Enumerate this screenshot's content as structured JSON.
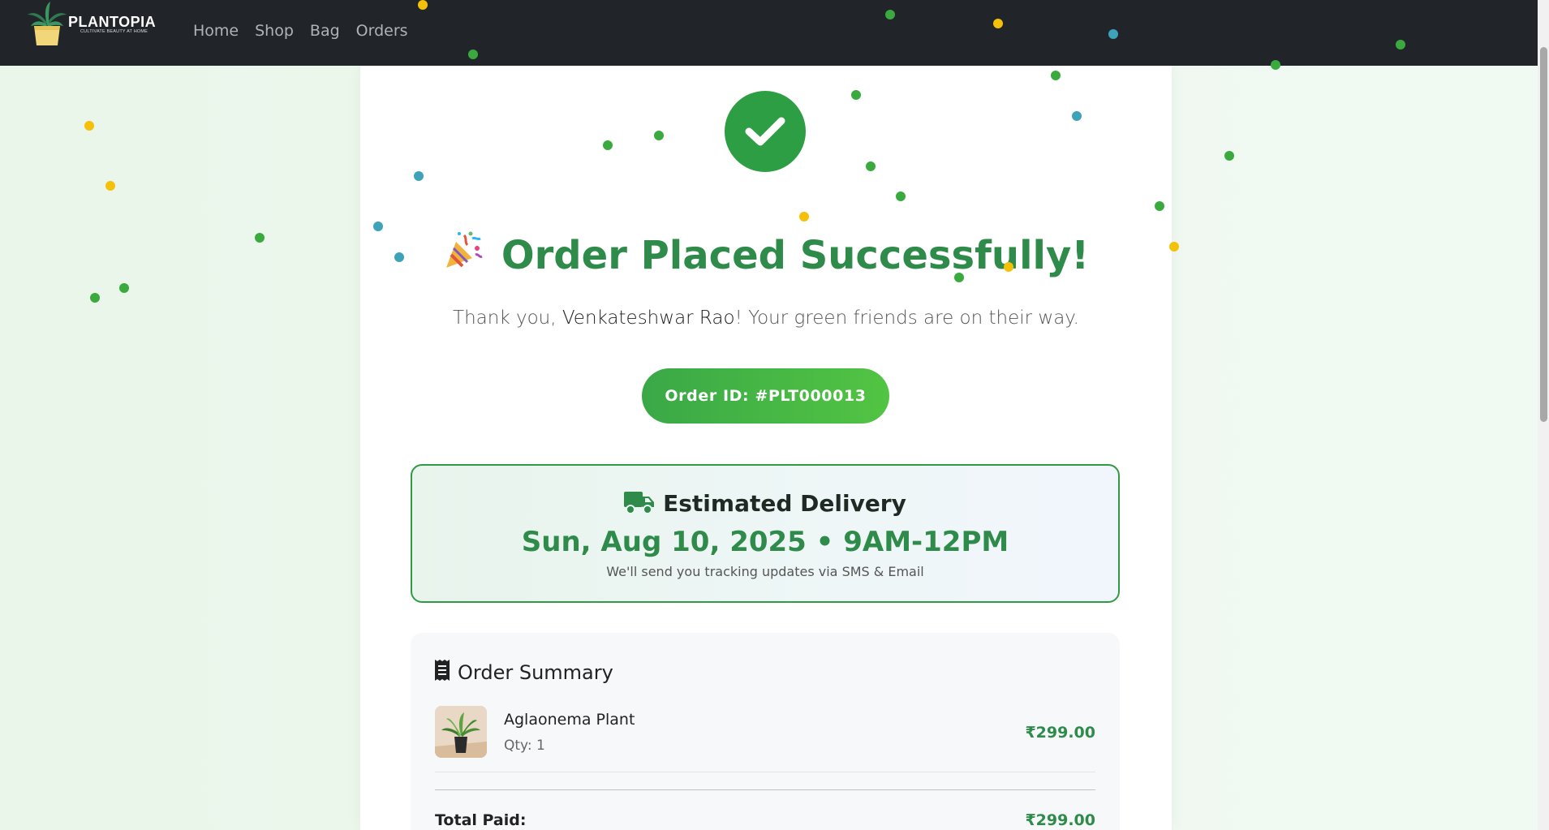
{
  "navbar": {
    "brand": "PLANTOPIA",
    "tagline": "CULTIVATE BEAUTY AT HOME",
    "links": [
      "Home",
      "Shop",
      "Bag",
      "Orders"
    ]
  },
  "confirmation": {
    "title": "Order Placed Successfully!",
    "thank_prefix": "Thank you, ",
    "customer_name": "Venkateshwar Rao",
    "thank_suffix": "! Your green friends are on their way.",
    "order_id": "Order ID: #PLT000013"
  },
  "delivery": {
    "heading": "Estimated Delivery",
    "date": "Sun, Aug 10, 2025 • 9AM-12PM",
    "note": "We'll send you tracking updates via SMS & Email"
  },
  "summary": {
    "heading": "Order Summary",
    "items": [
      {
        "name": "Aglaonema Plant",
        "qty": "Qty: 1",
        "price": "₹299.00"
      }
    ],
    "total_label": "Total Paid:",
    "total_value": "₹299.00"
  },
  "colors": {
    "accent_green": "#2e8b4a",
    "navbar_bg": "#212529",
    "confetti": [
      "#3aaa3e",
      "#f5c108",
      "#3ea2b9"
    ]
  }
}
